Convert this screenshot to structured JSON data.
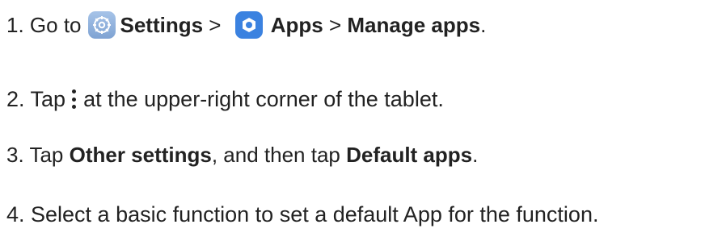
{
  "step1": {
    "prefix": "1. Go to",
    "settings_label": "Settings",
    "separator1": " > ",
    "apps_label": "Apps",
    "separator2": " > ",
    "manage_label": "Manage apps",
    "end": ".",
    "settings_icon": "settings-gear-icon",
    "apps_icon": "apps-icon"
  },
  "step2": {
    "prefix": "2. Tap",
    "icon": "more-options-kebab-icon",
    "suffix": "at the upper-right corner of the tablet."
  },
  "step3": {
    "prefix": "3. Tap ",
    "other_settings": "Other settings",
    "middle": ", and then tap ",
    "default_apps": "Default apps",
    "end": "."
  },
  "step4": {
    "text": "4. Select a basic function to set a default App for the function."
  },
  "colors": {
    "text": "#222222",
    "settings_icon_bg": "#8fb1de",
    "apps_icon_bg": "#3b82e0"
  }
}
